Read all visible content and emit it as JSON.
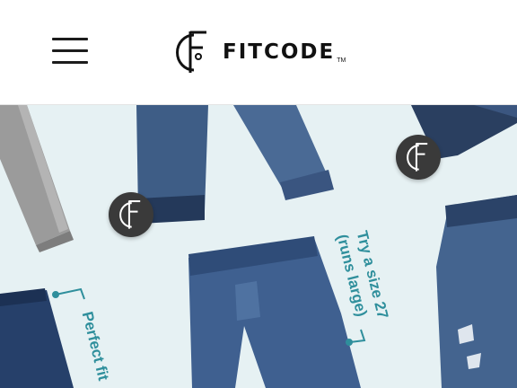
{
  "header": {
    "menu_icon": "hamburger-menu-icon",
    "logo_text": "FITCODE",
    "logo_tm": "TM"
  },
  "hero": {
    "annotations": {
      "size_line1": "Try a size 27",
      "size_line2": "(runs large)",
      "perfect": "Perfect fit"
    },
    "badge_icon": "fitcode-logo-badge",
    "colors": {
      "background": "#e6f1f3",
      "annotation": "#2f8f9c",
      "denim_dark": "#24395a",
      "denim_mid": "#3e5d86",
      "denim_gray": "#9b9b9b"
    }
  }
}
